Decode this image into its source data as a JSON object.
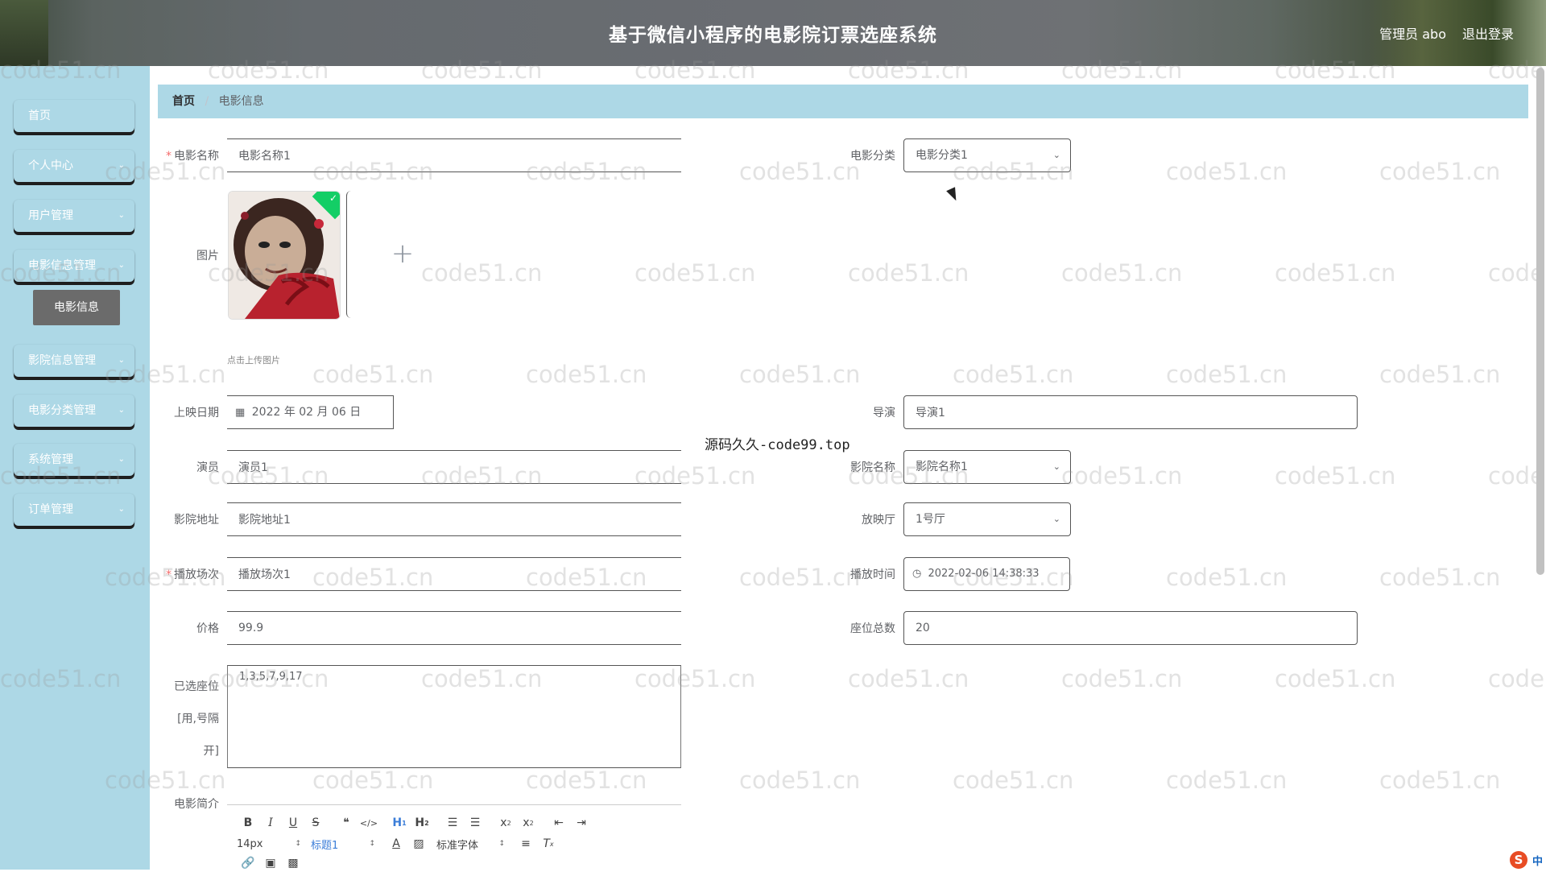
{
  "header": {
    "title": "基于微信小程序的电影院订票选座系统",
    "user": "管理员 abo",
    "logout": "退出登录"
  },
  "sidebar": {
    "items": [
      {
        "label": "首页",
        "has_children": false
      },
      {
        "label": "个人中心",
        "has_children": true
      },
      {
        "label": "用户管理",
        "has_children": true
      },
      {
        "label": "电影信息管理",
        "has_children": true
      },
      {
        "label": "影院信息管理",
        "has_children": true
      },
      {
        "label": "电影分类管理",
        "has_children": true
      },
      {
        "label": "系统管理",
        "has_children": true
      },
      {
        "label": "订单管理",
        "has_children": true
      }
    ],
    "active_sub": "电影信息"
  },
  "breadcrumb": {
    "home": "首页",
    "current": "电影信息"
  },
  "form": {
    "movie_name": {
      "label": "电影名称",
      "value": "电影名称1",
      "required": true
    },
    "category": {
      "label": "电影分类",
      "value": "电影分类1"
    },
    "picture": {
      "label": "图片",
      "tip": "点击上传图片"
    },
    "release_date": {
      "label": "上映日期",
      "value": "2022 年 02 月 06 日"
    },
    "director": {
      "label": "导演",
      "value": "导演1"
    },
    "actor": {
      "label": "演员",
      "value": "演员1"
    },
    "cinema_name": {
      "label": "影院名称",
      "value": "影院名称1"
    },
    "cinema_address": {
      "label": "影院地址",
      "value": "影院地址1"
    },
    "hall": {
      "label": "放映厅",
      "value": "1号厅"
    },
    "session": {
      "label": "播放场次",
      "value": "播放场次1",
      "required": true
    },
    "play_time": {
      "label": "播放时间",
      "value": "2022-02-06 14:38:33"
    },
    "price": {
      "label": "价格",
      "value": "99.9"
    },
    "total_seats": {
      "label": "座位总数",
      "value": "20"
    },
    "selected_seats": {
      "label_line1": "已选座位",
      "label_line2": "[用,号隔",
      "label_line3": "开]",
      "value": "1,3,5,7,9,17"
    },
    "intro": {
      "label": "电影简介"
    }
  },
  "editor": {
    "font_size": "14px",
    "heading": "标题1",
    "font_family": "标准字体"
  },
  "watermark": {
    "text": "code51.cn",
    "code_text": "源码久久-code99.top"
  },
  "tray": {
    "lang": "中"
  },
  "colors": {
    "sidebar_bg": "#add8e6",
    "active_sub_bg": "#6b6b6b",
    "required": "#f56c6c",
    "upload_success": "#13ce66"
  }
}
